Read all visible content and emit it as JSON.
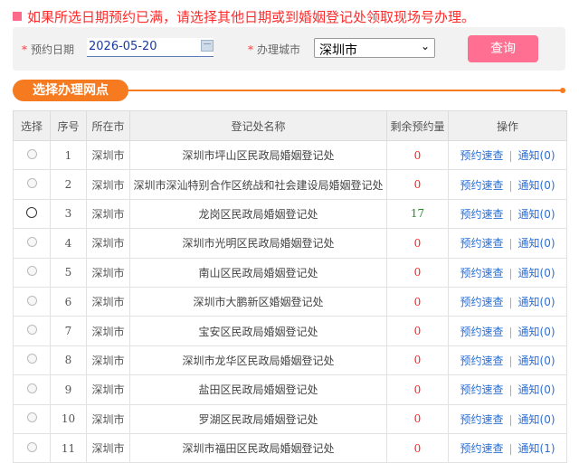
{
  "notice": "如果所选日期预约已满，请选择其他日期或到婚姻登记处领取现场号办理。",
  "search": {
    "date_label": "预约日期",
    "date_value": "2026-05-20",
    "city_label": "办理城市",
    "city_value": "深圳市",
    "query_label": "查询"
  },
  "section_title": "选择办理网点",
  "table": {
    "headers": [
      "选择",
      "序号",
      "所在市",
      "登记处名称",
      "剩余预约量",
      "操作"
    ],
    "op_book": "预约速查",
    "rows": [
      {
        "no": "1",
        "city": "深圳市",
        "name": "深圳市坪山区民政局婚姻登记处",
        "quota": "0",
        "notice": "通知(0)"
      },
      {
        "no": "2",
        "city": "深圳市",
        "name": "深圳市深汕特别合作区统战和社会建设局婚姻登记处",
        "quota": "0",
        "notice": "通知(0)"
      },
      {
        "no": "3",
        "city": "深圳市",
        "name": "龙岗区民政局婚姻登记处",
        "quota": "17",
        "notice": "通知(0)"
      },
      {
        "no": "4",
        "city": "深圳市",
        "name": "深圳市光明区民政局婚姻登记处",
        "quota": "0",
        "notice": "通知(0)"
      },
      {
        "no": "5",
        "city": "深圳市",
        "name": "南山区民政局婚姻登记处",
        "quota": "0",
        "notice": "通知(0)"
      },
      {
        "no": "6",
        "city": "深圳市",
        "name": "深圳市大鹏新区婚姻登记处",
        "quota": "0",
        "notice": "通知(0)"
      },
      {
        "no": "7",
        "city": "深圳市",
        "name": "宝安区民政局婚姻登记处",
        "quota": "0",
        "notice": "通知(0)"
      },
      {
        "no": "8",
        "city": "深圳市",
        "name": "深圳市龙华区民政局婚姻登记处",
        "quota": "0",
        "notice": "通知(0)"
      },
      {
        "no": "9",
        "city": "深圳市",
        "name": "盐田区民政局婚姻登记处",
        "quota": "0",
        "notice": "通知(0)"
      },
      {
        "no": "10",
        "city": "深圳市",
        "name": "罗湖区民政局婚姻登记处",
        "quota": "0",
        "notice": "通知(0)"
      },
      {
        "no": "11",
        "city": "深圳市",
        "name": "深圳市福田区民政局婚姻登记处",
        "quota": "0",
        "notice": "通知(1)"
      }
    ]
  },
  "colors": {
    "accent": "#f57a20",
    "button": "#ff6f91",
    "alert": "#ff2a2a",
    "link": "#2a6fd6"
  }
}
